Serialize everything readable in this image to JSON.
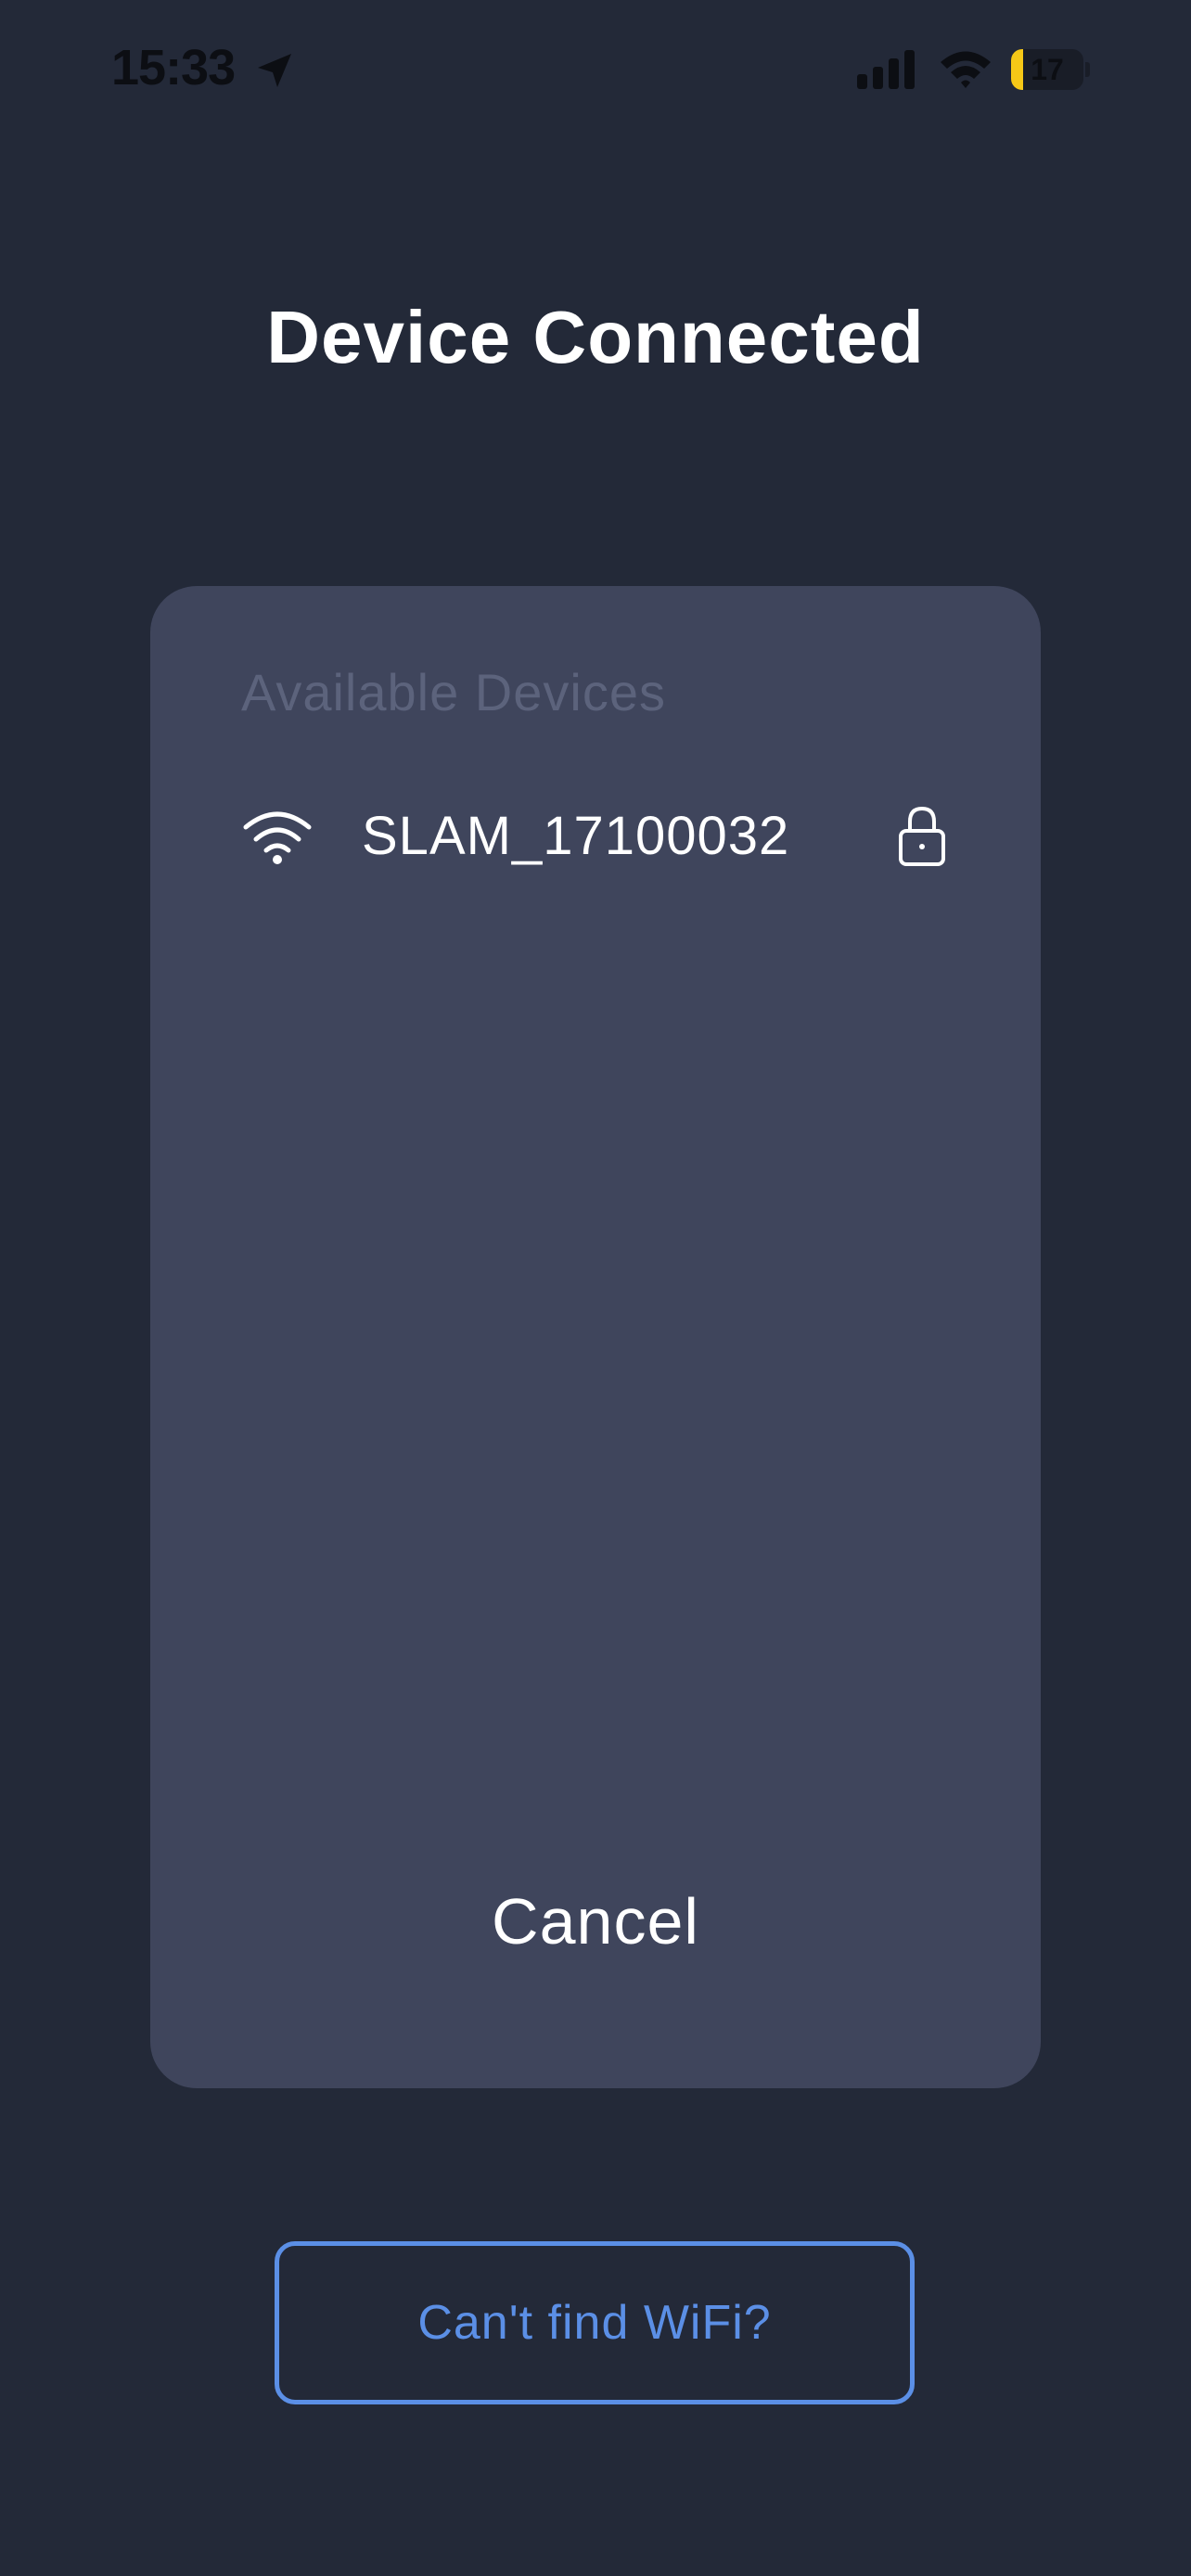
{
  "status_bar": {
    "time": "15:33",
    "battery_percent": "17",
    "battery_level": 0.17,
    "icons": [
      "location-arrow-icon",
      "cellular-signal-icon",
      "wifi-icon",
      "battery-icon"
    ]
  },
  "page": {
    "title": "Device Connected"
  },
  "device_panel": {
    "heading": "Available Devices",
    "devices": [
      {
        "name": "SLAM_17100032",
        "icon": "wifi-icon",
        "secured": true
      }
    ],
    "cancel_label": "Cancel"
  },
  "help_button": {
    "label": "Can't find WiFi?"
  },
  "colors": {
    "background": "#232938",
    "panel": "#3f455c",
    "accent": "#5b8fe6",
    "battery_fill": "#f6c817",
    "muted_text": "#5c637c"
  }
}
